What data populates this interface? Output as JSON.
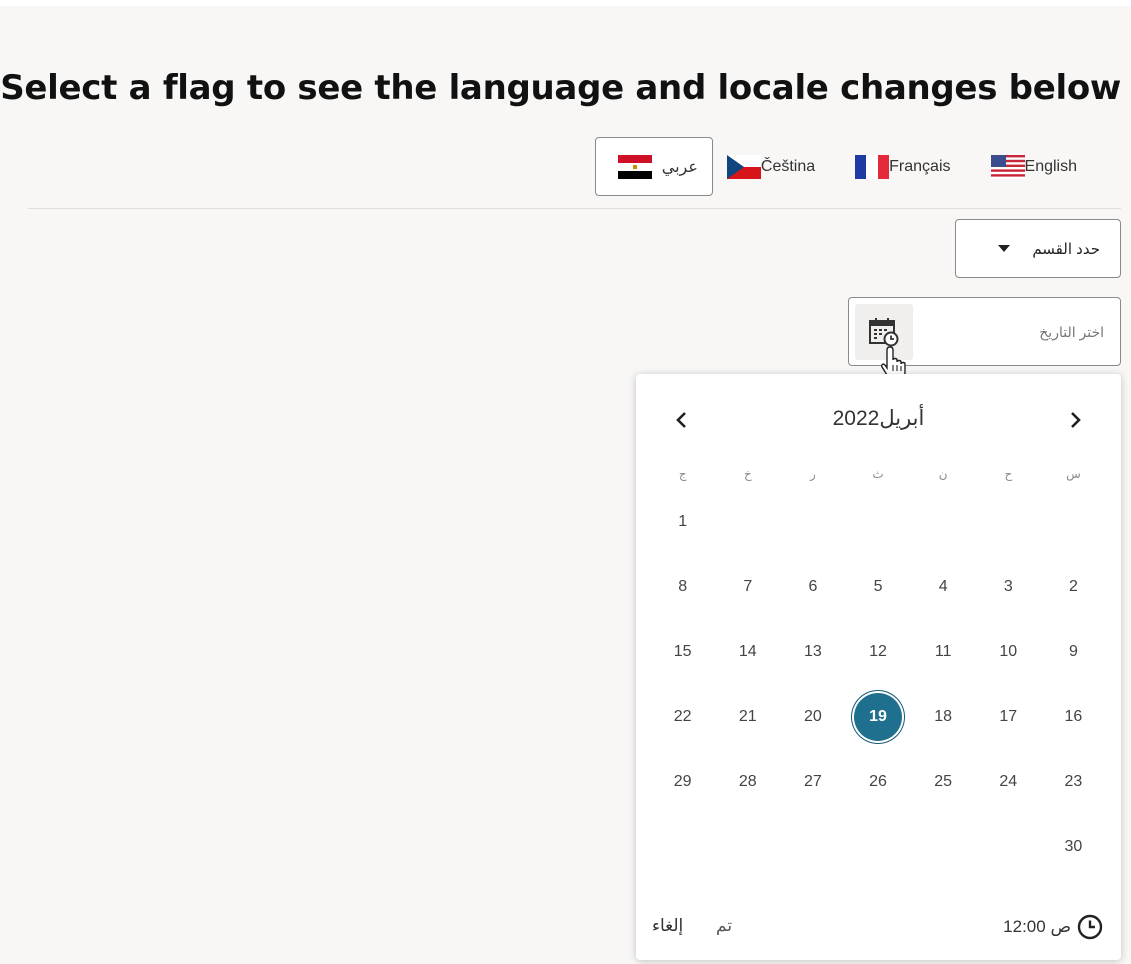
{
  "heading": "Select a flag to see the language and locale changes below",
  "flags": [
    {
      "label": "English",
      "icon": "us-flag-icon"
    },
    {
      "label": "Français",
      "icon": "france-flag-icon"
    },
    {
      "label": "Čeština",
      "icon": "czech-flag-icon"
    },
    {
      "label": "عربي",
      "icon": "egypt-flag-icon",
      "selected": true
    }
  ],
  "section_select": {
    "label": "حدد القسم"
  },
  "date_input": {
    "placeholder": "اختر التاريخ"
  },
  "calendar": {
    "title": "أبريل2022",
    "weekdays": [
      "س",
      "ح",
      "ن",
      "ث",
      "ر",
      "خ",
      "ج"
    ],
    "weeks": [
      [
        "",
        "",
        "",
        "",
        "",
        "",
        "1"
      ],
      [
        "2",
        "3",
        "4",
        "5",
        "6",
        "7",
        "8"
      ],
      [
        "9",
        "10",
        "11",
        "12",
        "13",
        "14",
        "15"
      ],
      [
        "16",
        "17",
        "18",
        "19",
        "20",
        "21",
        "22"
      ],
      [
        "23",
        "24",
        "25",
        "26",
        "27",
        "28",
        "29"
      ],
      [
        "30",
        "",
        "",
        "",
        "",
        "",
        ""
      ]
    ],
    "selected_day": "19",
    "time": "12:00 ص",
    "done_label": "تم",
    "cancel_label": "إلغاء"
  },
  "colors": {
    "accent": "#1f6f8f",
    "background": "#f8f7f6"
  }
}
